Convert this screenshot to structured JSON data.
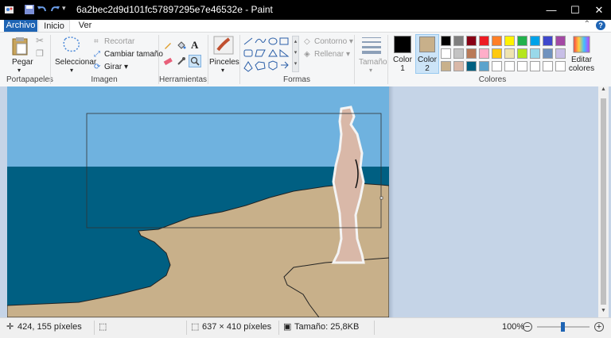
{
  "window": {
    "title": "6a2bec2d9d101fc57897295e7e46532e - Paint"
  },
  "tabs": {
    "archivo": "Archivo",
    "inicio": "Inicio",
    "ver": "Ver"
  },
  "ribbon": {
    "portapapeles": {
      "label": "Portapapeles",
      "pegar": "Pegar"
    },
    "imagen": {
      "label": "Imagen",
      "seleccionar": "Seleccionar",
      "recortar": "Recortar",
      "cambiar_tamano": "Cambiar tamaño",
      "girar": "Girar"
    },
    "herramientas": {
      "label": "Herramientas"
    },
    "pinceles": "Pinceles",
    "formas": {
      "label": "Formas",
      "contorno": "Contorno",
      "rellenar": "Rellenar"
    },
    "tamano": "Tamaño",
    "colores": {
      "label": "Colores",
      "color1_label": "Color 1",
      "color2_label": "Color 2",
      "color1": "#000000",
      "color2": "#c8b08a",
      "editar": "Editar colores",
      "palette_row1": [
        "#000000",
        "#7f7f7f",
        "#880015",
        "#ed1c24",
        "#ff7f27",
        "#fff200",
        "#22b14c",
        "#00a2e8",
        "#3f48cc",
        "#a349a4"
      ],
      "palette_row2": [
        "#ffffff",
        "#c3c3c3",
        "#b97a57",
        "#ffaec9",
        "#ffc90e",
        "#efe4b0",
        "#b5e61d",
        "#99d9ea",
        "#7092be",
        "#c8bfe7"
      ],
      "palette_row3": [
        "#c8b08a",
        "#d9b8a8",
        "#005f7f",
        "#5ba3cc",
        "#ffffff",
        "#ffffff",
        "#ffffff",
        "#ffffff",
        "#ffffff",
        "#ffffff"
      ]
    }
  },
  "status": {
    "cursor": "424, 155 píxeles",
    "dimensions": "637 × 410 píxeles",
    "size": "Tamaño: 25,8KB",
    "zoom": "100%"
  }
}
